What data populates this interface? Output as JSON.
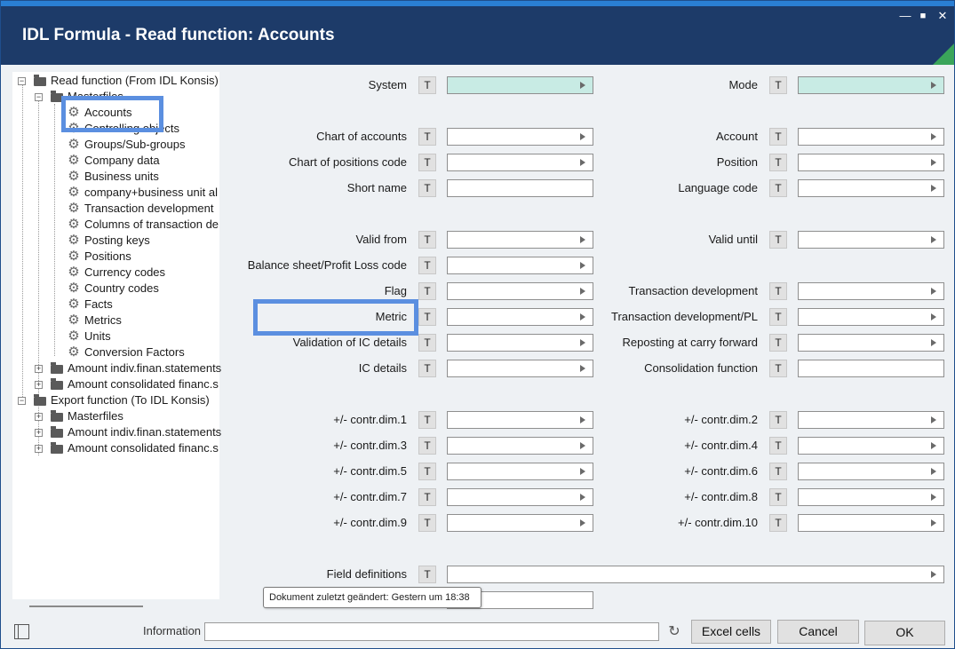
{
  "window": {
    "title": "IDL Formula - Read function: Accounts",
    "controls": [
      "minimize",
      "maximize",
      "close"
    ]
  },
  "tree": {
    "root1": {
      "label": "Read function (From IDL Konsis)",
      "masterfiles": {
        "label": "Masterfiles",
        "items": [
          "Accounts",
          "Controlling objects",
          "Groups/Sub-groups",
          "Company data",
          "Business units",
          "company+business unit al",
          "Transaction development",
          "Columns of transaction de",
          "Posting keys",
          "Positions",
          "Currency codes",
          "Country codes",
          "Facts",
          "Metrics",
          "Units",
          "Conversion Factors"
        ]
      },
      "folders": [
        "Amount indiv.finan.statements",
        "Amount consolidated financ.s"
      ]
    },
    "root2": {
      "label": "Export function (To IDL Konsis)",
      "folders": [
        "Masterfiles",
        "Amount indiv.finan.statements",
        "Amount consolidated financ.s"
      ]
    }
  },
  "form": {
    "t_label": "T",
    "left": {
      "system": "System",
      "chart_of_accounts": "Chart of accounts",
      "chart_of_positions": "Chart of positions code",
      "short_name": "Short name",
      "valid_from": "Valid from",
      "balance_sheet": "Balance sheet/Profit  Loss code",
      "flag": "Flag",
      "metric": "Metric",
      "validation_ic": "Validation of IC details",
      "ic_details": "IC details",
      "dim1": "+/- contr.dim.1",
      "dim3": "+/- contr.dim.3",
      "dim5": "+/- contr.dim.5",
      "dim7": "+/- contr.dim.7",
      "dim9": "+/- contr.dim.9",
      "field_definitions": "Field definitions"
    },
    "right": {
      "mode": "Mode",
      "account": "Account",
      "position": "Position",
      "language_code": "Language code",
      "valid_until": "Valid until",
      "transaction_development": "Transaction development",
      "transaction_development_pl": "Transaction development/PL",
      "reposting": "Reposting at carry forward",
      "consolidation_function": "Consolidation function",
      "dim2": "+/- contr.dim.2",
      "dim4": "+/- contr.dim.4",
      "dim6": "+/- contr.dim.6",
      "dim8": "+/- contr.dim.8",
      "dim10": "+/- contr.dim.10"
    },
    "tooltip": "Dokument zuletzt geändert: Gestern um 18:38"
  },
  "footer": {
    "information_label": "Information",
    "information_value": "",
    "excel_cells": "Excel cells",
    "cancel": "Cancel",
    "ok": "OK"
  },
  "colors": {
    "titlebar": "#1d3b69",
    "accent_top": "#2a7fd4",
    "system_field": "#c8ebe4",
    "highlight": "#5b8fe0",
    "corner": "#3aa55a"
  }
}
